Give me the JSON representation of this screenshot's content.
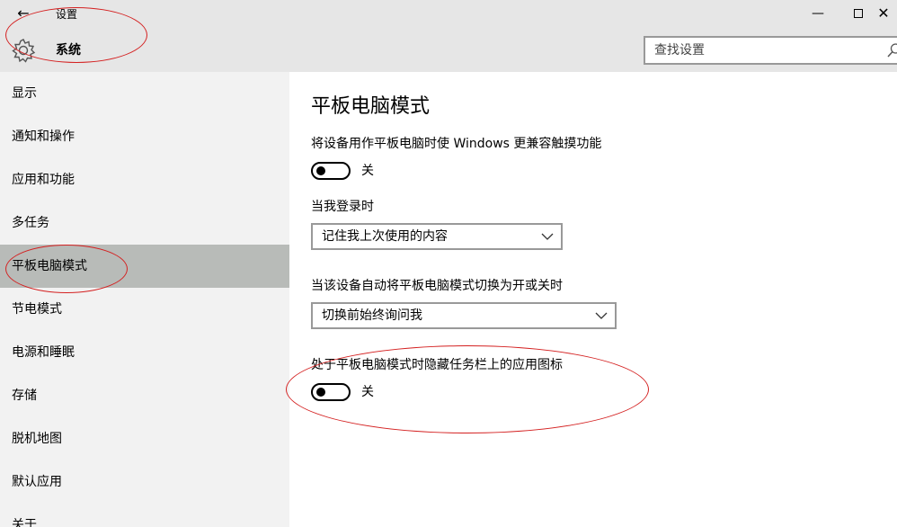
{
  "window": {
    "title": "设置",
    "back_icon": "←",
    "minimize_icon": "—",
    "close_icon": "✕"
  },
  "header": {
    "section_title": "系统",
    "search_placeholder": "查找设置"
  },
  "sidebar": {
    "items": [
      {
        "label": "显示"
      },
      {
        "label": "通知和操作"
      },
      {
        "label": "应用和功能"
      },
      {
        "label": "多任务"
      },
      {
        "label": "平板电脑模式",
        "selected": true
      },
      {
        "label": "节电模式"
      },
      {
        "label": "电源和睡眠"
      },
      {
        "label": "存储"
      },
      {
        "label": "脱机地图"
      },
      {
        "label": "默认应用"
      },
      {
        "label": "关于"
      }
    ]
  },
  "main": {
    "title": "平板电脑模式",
    "setting1": {
      "label": "将设备用作平板电脑时使 Windows 更兼容触摸功能",
      "state": "关"
    },
    "setting2": {
      "label": "当我登录时",
      "value": "记住我上次使用的内容"
    },
    "setting3": {
      "label": "当该设备自动将平板电脑模式切换为开或关时",
      "value": "切换前始终询问我"
    },
    "setting4": {
      "label": "处于平板电脑模式时隐藏任务栏上的应用图标",
      "state": "关"
    }
  },
  "colors": {
    "titlebar_bg": "#e6e6e6",
    "sidebar_bg": "#f2f2f2",
    "selected_bg": "#b8bbb8",
    "annotation": "#d42020"
  }
}
